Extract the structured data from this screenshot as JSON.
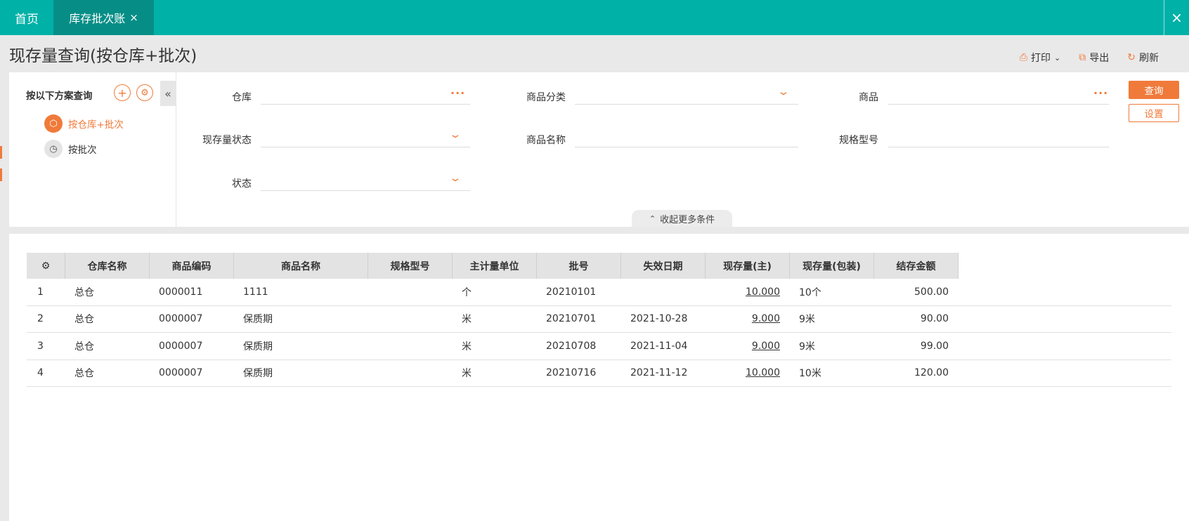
{
  "topbar": {
    "home_tab": "首页",
    "active_tab": "库存批次账",
    "tab_close": "×",
    "window_close": "×"
  },
  "page": {
    "title": "现存量查询(按仓库+批次)"
  },
  "toolbar": {
    "print": "打印",
    "export": "导出",
    "refresh": "刷新"
  },
  "scheme": {
    "title": "按以下方案查询",
    "items": [
      {
        "label": "按仓库+批次",
        "selected": true
      },
      {
        "label": "按批次",
        "selected": false
      }
    ]
  },
  "filters": {
    "warehouse": {
      "label": "仓库",
      "value": ""
    },
    "category": {
      "label": "商品分类",
      "value": ""
    },
    "product": {
      "label": "商品",
      "value": ""
    },
    "stock_status": {
      "label": "现存量状态",
      "value": ""
    },
    "product_name": {
      "label": "商品名称",
      "value": ""
    },
    "spec": {
      "label": "规格型号",
      "value": ""
    },
    "status": {
      "label": "状态",
      "value": ""
    },
    "collapse_label": "收起更多条件",
    "query_button": "查询",
    "settings_button": "设置"
  },
  "grid": {
    "columns": [
      "",
      "仓库名称",
      "商品编码",
      "商品名称",
      "规格型号",
      "主计量单位",
      "批号",
      "失效日期",
      "现存量(主)",
      "现存量(包装)",
      "结存金额"
    ],
    "rows": [
      [
        "1",
        "总仓",
        "0000011",
        "1111",
        "",
        "个",
        "20210101",
        "",
        "10.000",
        "10个",
        "500.00"
      ],
      [
        "2",
        "总仓",
        "0000007",
        "保质期",
        "",
        "米",
        "20210701",
        "2021-10-28",
        "9.000",
        "9米",
        "90.00"
      ],
      [
        "3",
        "总仓",
        "0000007",
        "保质期",
        "",
        "米",
        "20210708",
        "2021-11-04",
        "9.000",
        "9米",
        "99.00"
      ],
      [
        "4",
        "总仓",
        "0000007",
        "保质期",
        "",
        "米",
        "20210716",
        "2021-11-12",
        "10.000",
        "10米",
        "120.00"
      ]
    ]
  },
  "colors": {
    "topbar": "#00b1a7",
    "active_tab": "#068e86",
    "accent": "#f07a3a"
  }
}
